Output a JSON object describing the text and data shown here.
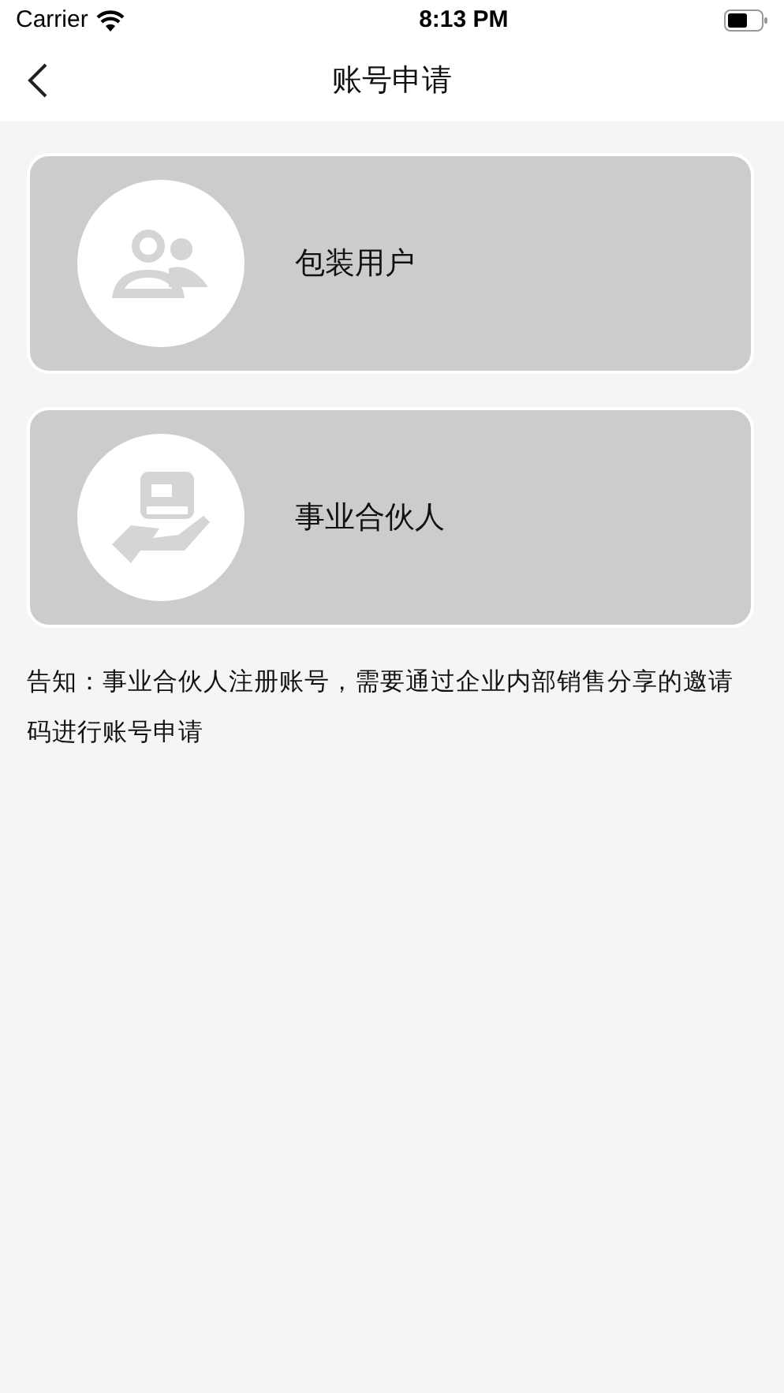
{
  "status_bar": {
    "carrier": "Carrier",
    "time": "8:13 PM"
  },
  "nav_bar": {
    "title": "账号申请"
  },
  "options": [
    {
      "kind": "users",
      "label": "包装用户"
    },
    {
      "kind": "hand",
      "label": "事业合伙人"
    }
  ],
  "notice": "告知：事业合伙人注册账号，需要通过企业内部销售分享的邀请码进行账号申请"
}
